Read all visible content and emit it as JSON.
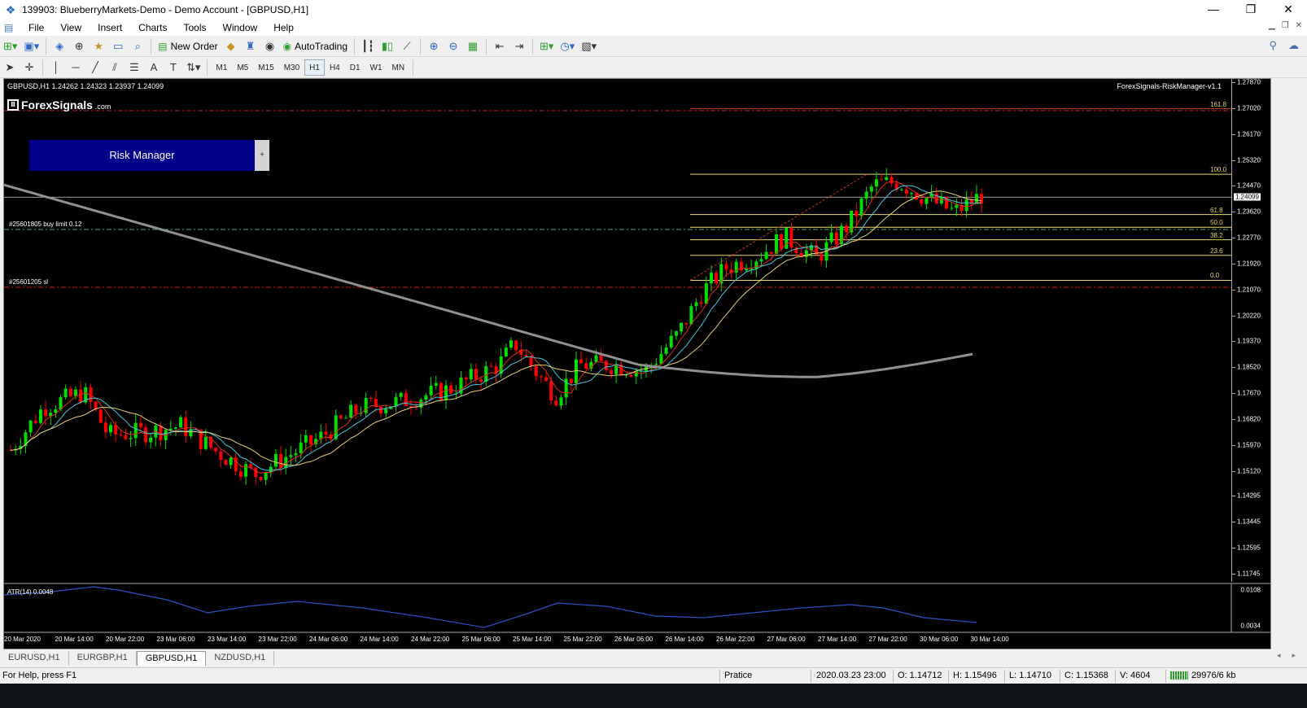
{
  "window": {
    "title": "139903: BlueberryMarkets-Demo - Demo Account - [GBPUSD,H1]",
    "minimize": "—",
    "restore": "❐",
    "close": "✕"
  },
  "menu": [
    "File",
    "View",
    "Insert",
    "Charts",
    "Tools",
    "Window",
    "Help"
  ],
  "toolbar": {
    "new_order": "New Order",
    "auto_trading": "AutoTrading"
  },
  "timeframes": [
    {
      "label": "M1",
      "active": false
    },
    {
      "label": "M5",
      "active": false
    },
    {
      "label": "M15",
      "active": false
    },
    {
      "label": "M30",
      "active": false
    },
    {
      "label": "H1",
      "active": true
    },
    {
      "label": "H4",
      "active": false
    },
    {
      "label": "D1",
      "active": false
    },
    {
      "label": "W1",
      "active": false
    },
    {
      "label": "MN",
      "active": false
    }
  ],
  "chart": {
    "header": "GBPUSD,H1  1.24262 1.24323 1.23937 1.24099",
    "logo_text": "ForexSignals",
    "logo_sub": ".com",
    "ea_label": "ForexSignals-RiskManager-v1.1",
    "risk_button": "Risk Manager",
    "risk_plus": "+",
    "buy_limit_label": "#25601805 buy limit 0.12",
    "sl_label": "#25601205 sl",
    "current_price": "1.24099",
    "atr_label": "ATR(14) 0.0048",
    "price_labels": [
      "1.27870",
      "1.27020",
      "1.26170",
      "1.25320",
      "1.24470",
      "1.23620",
      "1.22770",
      "1.21920",
      "1.21070",
      "1.20220",
      "1.19370",
      "1.18520",
      "1.17670",
      "1.16820",
      "1.15970",
      "1.15120",
      "1.14295",
      "1.13445",
      "1.12595",
      "1.11745"
    ],
    "atr_axis": [
      "0.0108",
      "0.0034"
    ],
    "fib_levels": [
      {
        "label": "161.8",
        "price": 1.27
      },
      {
        "label": "100.0",
        "price": 1.2485
      },
      {
        "label": "61.8",
        "price": 1.2353
      },
      {
        "label": "50.0",
        "price": 1.2311
      },
      {
        "label": "38.2",
        "price": 1.227
      },
      {
        "label": "23.6",
        "price": 1.2219
      },
      {
        "label": "0.0",
        "price": 1.2137
      }
    ],
    "time_labels": [
      "20 Mar 2020",
      "20 Mar 14:00",
      "20 Mar 22:00",
      "23 Mar 06:00",
      "23 Mar 14:00",
      "23 Mar 22:00",
      "24 Mar 06:00",
      "24 Mar 14:00",
      "24 Mar 22:00",
      "25 Mar 06:00",
      "25 Mar 14:00",
      "25 Mar 22:00",
      "26 Mar 06:00",
      "26 Mar 14:00",
      "26 Mar 22:00",
      "27 Mar 06:00",
      "27 Mar 14:00",
      "27 Mar 22:00",
      "30 Mar 06:00",
      "30 Mar 14:00"
    ],
    "colors": {
      "bull": "#00e000",
      "bear": "#ff0000",
      "grid": "#ffffff",
      "fib": "#e8d870",
      "ma_fast": "#e03020",
      "ma_mid": "#40c8e0",
      "ma_slow": "#e8d070",
      "ma_long": "#909090",
      "atr": "#3050c0"
    }
  },
  "tabs": [
    {
      "label": "EURUSD,H1",
      "active": false
    },
    {
      "label": "EURGBP,H1",
      "active": false
    },
    {
      "label": "GBPUSD,H1",
      "active": true
    },
    {
      "label": "NZDUSD,H1",
      "active": false
    }
  ],
  "status": {
    "help": "For Help, press F1",
    "profile": "Pratice",
    "datetime": "2020.03.23 23:00",
    "open": "O: 1.14712",
    "high": "H: 1.15496",
    "low": "L: 1.14710",
    "close": "C: 1.15368",
    "volume": "V: 4604",
    "traffic": "29976/6 kb"
  }
}
